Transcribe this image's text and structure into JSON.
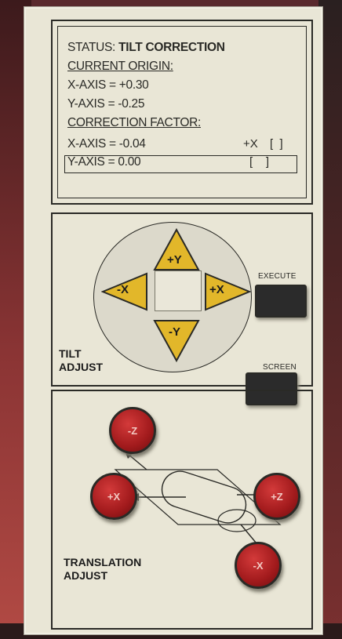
{
  "status": {
    "label": "STATUS:",
    "value": "TILT CORRECTION",
    "current_origin_heading": "CURRENT ORIGIN:",
    "origin_x": "X-AXIS = +0.30",
    "origin_y": "Y-AXIS = -0.25",
    "correction_heading": "CORRECTION FACTOR:",
    "corr_x": "X-AXIS = -0.04",
    "corr_x_dir": "+X",
    "corr_y": "Y-AXIS = 0.00"
  },
  "tilt": {
    "title_line1": "TILT",
    "title_line2": "ADJUST",
    "up": "+Y",
    "down": "-Y",
    "left": "-X",
    "right": "+X"
  },
  "keys": {
    "execute": "EXECUTE",
    "screen": "SCREEN"
  },
  "translation": {
    "title_line1": "TRANSLATION",
    "title_line2": "ADJUST",
    "btn_top_left": "-Z",
    "btn_mid_left": "+X",
    "btn_mid_right": "+Z",
    "btn_bottom_right": "-X"
  },
  "colors": {
    "panel": "#e9e6d6",
    "arrow_yellow": "#e2b72a",
    "button_red": "#b31c1f"
  }
}
